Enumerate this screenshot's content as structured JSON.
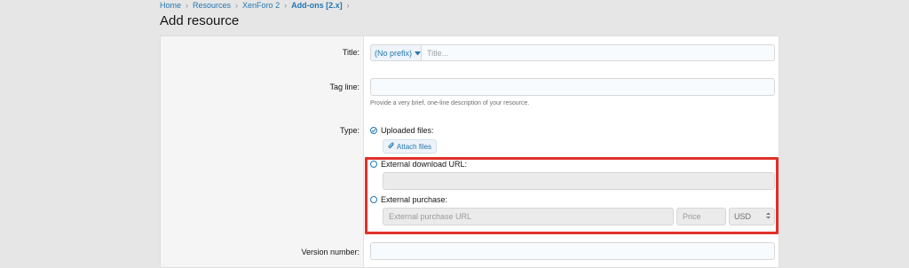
{
  "breadcrumb": {
    "items": [
      "Home",
      "Resources",
      "XenForo 2",
      "Add-ons [2.x]"
    ]
  },
  "page": {
    "title": "Add resource"
  },
  "form": {
    "title_label": "Title:",
    "prefix_value": "(No prefix)",
    "title_placeholder": "Title...",
    "tagline_label": "Tag line:",
    "tagline_hint": "Provide a very brief, one-line description of your resource.",
    "type_label": "Type:",
    "type_options": {
      "uploaded": "Uploaded files:",
      "attach_button": "Attach files",
      "external_download": "External download URL:",
      "external_purchase": "External purchase:"
    },
    "purchase_url_placeholder": "External purchase URL",
    "price_placeholder": "Price",
    "currency_value": "USD",
    "version_label": "Version number:"
  },
  "colors": {
    "accent": "#2577b1",
    "highlight": "#e0302a"
  }
}
